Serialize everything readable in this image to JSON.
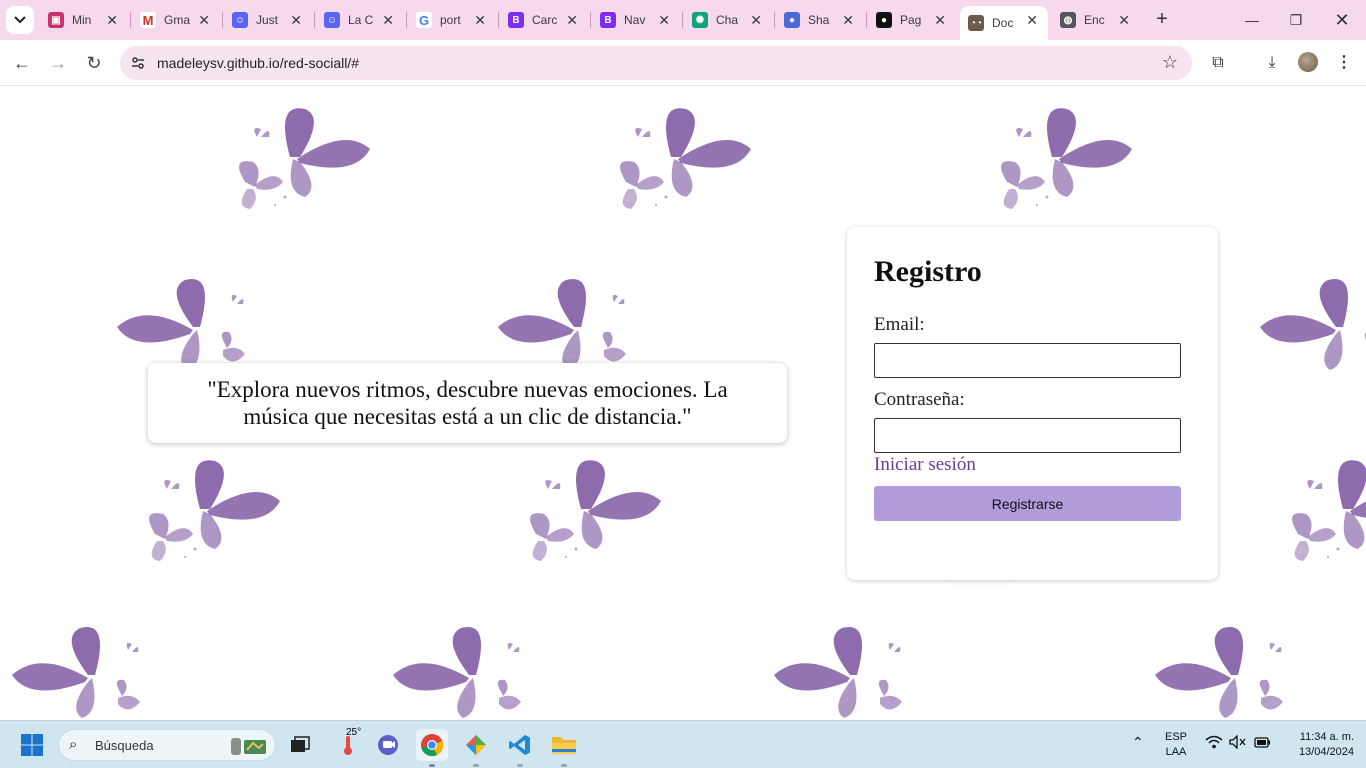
{
  "browser": {
    "tabs": [
      {
        "title": "Min",
        "favicon": "profile-icon",
        "color": "#c8326e"
      },
      {
        "title": "Gma",
        "favicon": "gmail-icon",
        "color": "#d93025"
      },
      {
        "title": "Just",
        "favicon": "discord-icon",
        "color": "#5865f2"
      },
      {
        "title": "La C",
        "favicon": "discord-icon",
        "color": "#5865f2"
      },
      {
        "title": "port",
        "favicon": "google-icon",
        "color": "#4285f4"
      },
      {
        "title": "Carc",
        "favicon": "bootstrap-icon",
        "color": "#7b2cf5"
      },
      {
        "title": "Nav",
        "favicon": "bootstrap-icon",
        "color": "#7b2cf5"
      },
      {
        "title": "Cha",
        "favicon": "chatgpt-icon",
        "color": "#10a37f"
      },
      {
        "title": "Sha",
        "favicon": "sphere-icon",
        "color": "#4b6ad6"
      },
      {
        "title": "Pag",
        "favicon": "github-icon",
        "color": "#111111"
      },
      {
        "title": "Doc",
        "favicon": "glasses-icon",
        "color": "#6a5a4a",
        "active": true
      },
      {
        "title": "Enc",
        "favicon": "globe-icon",
        "color": "#555555"
      }
    ],
    "url": "madeleysv.github.io/red-sociall/#"
  },
  "page": {
    "quote": "\"Explora nuevos ritmos, descubre nuevas emociones. La música que necesitas está a un clic de distancia.\"",
    "form": {
      "title": "Registro",
      "email_label": "Email:",
      "email_value": "",
      "password_label": "Contraseña:",
      "password_value": "",
      "login_link": "Iniciar sesión",
      "register_button": "Registrarse"
    }
  },
  "taskbar": {
    "search_placeholder": "Búsqueda",
    "weather_temp": "25°",
    "language": "ESP",
    "layout": "LAA",
    "time": "11:34 a. m.",
    "date": "13/04/2024"
  },
  "colors": {
    "tabstrip": "#f6d9ec",
    "accent_button": "#b19bd8",
    "link": "#6a3c99",
    "butterfly": "#7a519f"
  }
}
